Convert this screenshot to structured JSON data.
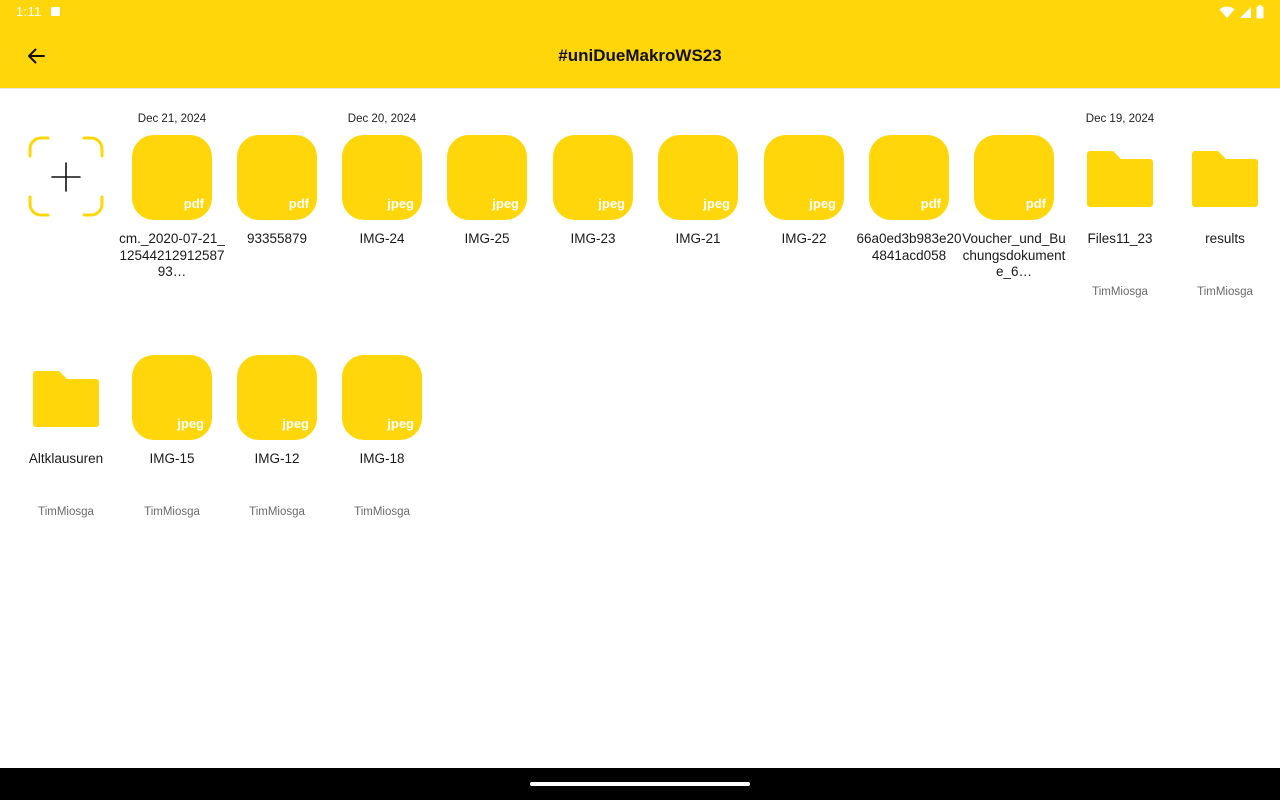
{
  "status_bar": {
    "time": "1:11"
  },
  "app_bar": {
    "title": "#uniDueMakroWS23"
  },
  "row1": [
    {
      "date": "Dec 21, 2024",
      "type": "file",
      "ext": "pdf",
      "name": "cm._2020-07-21_1254421291258793…",
      "owner": ""
    },
    {
      "date": "",
      "type": "file",
      "ext": "pdf",
      "name": "93355879",
      "owner": ""
    },
    {
      "date": "Dec 20, 2024",
      "type": "file",
      "ext": "jpeg",
      "name": "IMG-24",
      "owner": ""
    },
    {
      "date": "",
      "type": "file",
      "ext": "jpeg",
      "name": "IMG-25",
      "owner": ""
    },
    {
      "date": "",
      "type": "file",
      "ext": "jpeg",
      "name": "IMG-23",
      "owner": ""
    },
    {
      "date": "",
      "type": "file",
      "ext": "jpeg",
      "name": "IMG-21",
      "owner": ""
    },
    {
      "date": "",
      "type": "file",
      "ext": "jpeg",
      "name": "IMG-22",
      "owner": ""
    },
    {
      "date": "",
      "type": "file",
      "ext": "pdf",
      "name": "66a0ed3b983e204841acd058",
      "owner": ""
    },
    {
      "date": "",
      "type": "file",
      "ext": "pdf",
      "name": "Voucher_und_Buchungsdokumente_6…",
      "owner": ""
    },
    {
      "date": "Dec 19, 2024",
      "type": "folder",
      "ext": "",
      "name": "Files11_23",
      "owner": "TimMiosga"
    },
    {
      "date": "",
      "type": "folder",
      "ext": "",
      "name": "results",
      "owner": "TimMiosga"
    }
  ],
  "row2": [
    {
      "date": "",
      "type": "folder",
      "ext": "",
      "name": "Altklausuren",
      "owner": "TimMiosga"
    },
    {
      "date": "",
      "type": "file",
      "ext": "jpeg",
      "name": "IMG-15",
      "owner": "TimMiosga"
    },
    {
      "date": "",
      "type": "file",
      "ext": "jpeg",
      "name": "IMG-12",
      "owner": "TimMiosga"
    },
    {
      "date": "",
      "type": "file",
      "ext": "jpeg",
      "name": "IMG-18",
      "owner": "TimMiosga"
    }
  ],
  "colors": {
    "accent": "#FFD60A",
    "text": "#1a1a1a",
    "muted": "#6b6b6b"
  },
  "icons": {
    "back": "arrow-left-icon",
    "add": "plus-icon",
    "folder": "folder-icon"
  }
}
